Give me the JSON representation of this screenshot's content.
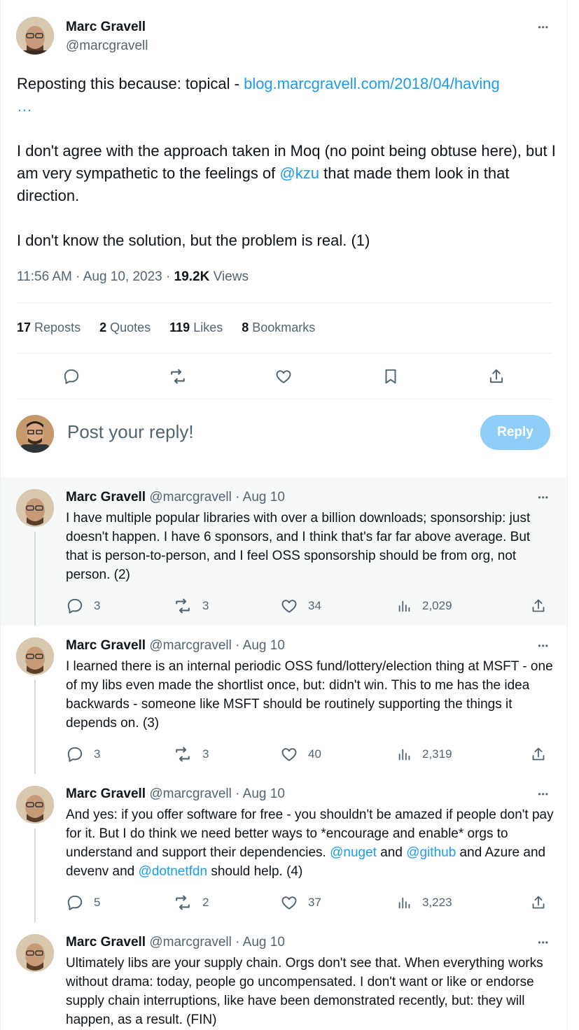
{
  "main": {
    "name": "Marc Gravell",
    "handle": "@marcgravell",
    "text_intro": "Reposting this because: topical - ",
    "link": "blog.marcgravell.com/2018/04/having",
    "link_ellipsis": "…",
    "p2_a": "I don't agree with the approach taken in Moq (no point being obtuse here), but I am very sympathetic to the feelings of ",
    "p2_mention": "@kzu",
    "p2_b": " that made them look in that direction.",
    "p3": "I don't know the solution, but the problem is real. (1)",
    "time": "11:56 AM · Aug 10, 2023 · ",
    "views_count": "19.2K",
    "views_label": " Views",
    "stats": [
      {
        "count": "17",
        "label": " Reposts"
      },
      {
        "count": "2",
        "label": " Quotes"
      },
      {
        "count": "119",
        "label": " Likes"
      },
      {
        "count": "8",
        "label": " Bookmarks"
      }
    ]
  },
  "reply": {
    "placeholder": "Post your reply!",
    "button": "Reply"
  },
  "thread": [
    {
      "name": "Marc Gravell",
      "handle": "@marcgravell · Aug 10",
      "text": "I have multiple popular libraries with over a billion downloads; sponsorship: just doesn't happen. I have 6 sponsors, and I think that's far far above average. But that is person-to-person, and I feel OSS sponsorship should be from org, not person. (2)",
      "replies": "3",
      "reposts": "3",
      "likes": "34",
      "views": "2,029"
    },
    {
      "name": "Marc Gravell",
      "handle": "@marcgravell · Aug 10",
      "text": "I learned there is an internal periodic OSS fund/lottery/election thing at MSFT - one of my libs even made the shortlist once, but: didn't win. This to me has the idea backwards - someone like MSFT should be routinely supporting the things it depends on. (3)",
      "replies": "3",
      "reposts": "3",
      "likes": "40",
      "views": "2,319"
    },
    {
      "name": "Marc Gravell",
      "handle": "@marcgravell · Aug 10",
      "text_a": "And yes: if you offer software for free - you shouldn't be amazed if people don't pay for it. But I do think we need better ways to *encourage and enable* orgs to understand and support their dependencies. ",
      "mention1": "@nuget",
      "text_b": " and ",
      "mention2": "@github",
      "text_c": " and Azure and devenv and ",
      "mention3": "@dotnetfdn",
      "text_d": " should help. (4)",
      "replies": "5",
      "reposts": "2",
      "likes": "37",
      "views": "3,223"
    },
    {
      "name": "Marc Gravell",
      "handle": "@marcgravell · Aug 10",
      "text": "Ultimately libs are your supply chain. Orgs don't see that. When everything works without drama: today, people go uncompensated. I don't want or like or endorse supply chain interruptions, like have been demonstrated recently, but: they will happen, as a result. (FIN)"
    }
  ],
  "more_symbol": "•••",
  "colors": {
    "link": "#1d9bf0",
    "muted": "#536471",
    "reply_button": "#8ecdf8",
    "divider": "#eff3f4",
    "thread_line": "#cfd9de"
  }
}
